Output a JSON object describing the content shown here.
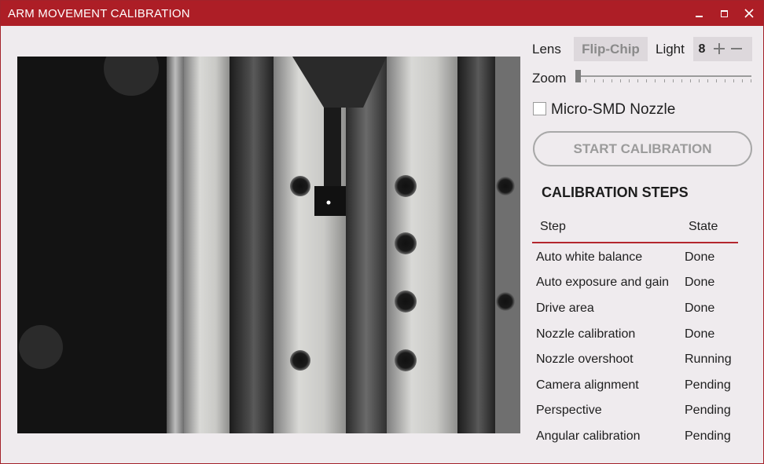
{
  "window": {
    "title": "ARM MOVEMENT CALIBRATION",
    "accent": "#ad1e26"
  },
  "controls": {
    "lens_label": "Lens",
    "lens_value": "Flip-Chip",
    "light_label": "Light",
    "light_value": "8",
    "zoom_label": "Zoom",
    "zoom_level": 0,
    "nozzle_checkbox_label": "Micro-SMD Nozzle",
    "nozzle_checked": false,
    "start_button": "START CALIBRATION"
  },
  "steps": {
    "title": "CALIBRATION STEPS",
    "headers": [
      "Step",
      "State"
    ],
    "rows": [
      {
        "step": "Auto white balance",
        "state": "Done"
      },
      {
        "step": "Auto exposure and gain",
        "state": "Done"
      },
      {
        "step": "Drive area",
        "state": "Done"
      },
      {
        "step": "Nozzle calibration",
        "state": "Done"
      },
      {
        "step": "Nozzle overshoot",
        "state": "Running"
      },
      {
        "step": "Camera alignment",
        "state": "Pending"
      },
      {
        "step": "Perspective",
        "state": "Pending"
      },
      {
        "step": "Angular calibration",
        "state": "Pending"
      }
    ]
  }
}
